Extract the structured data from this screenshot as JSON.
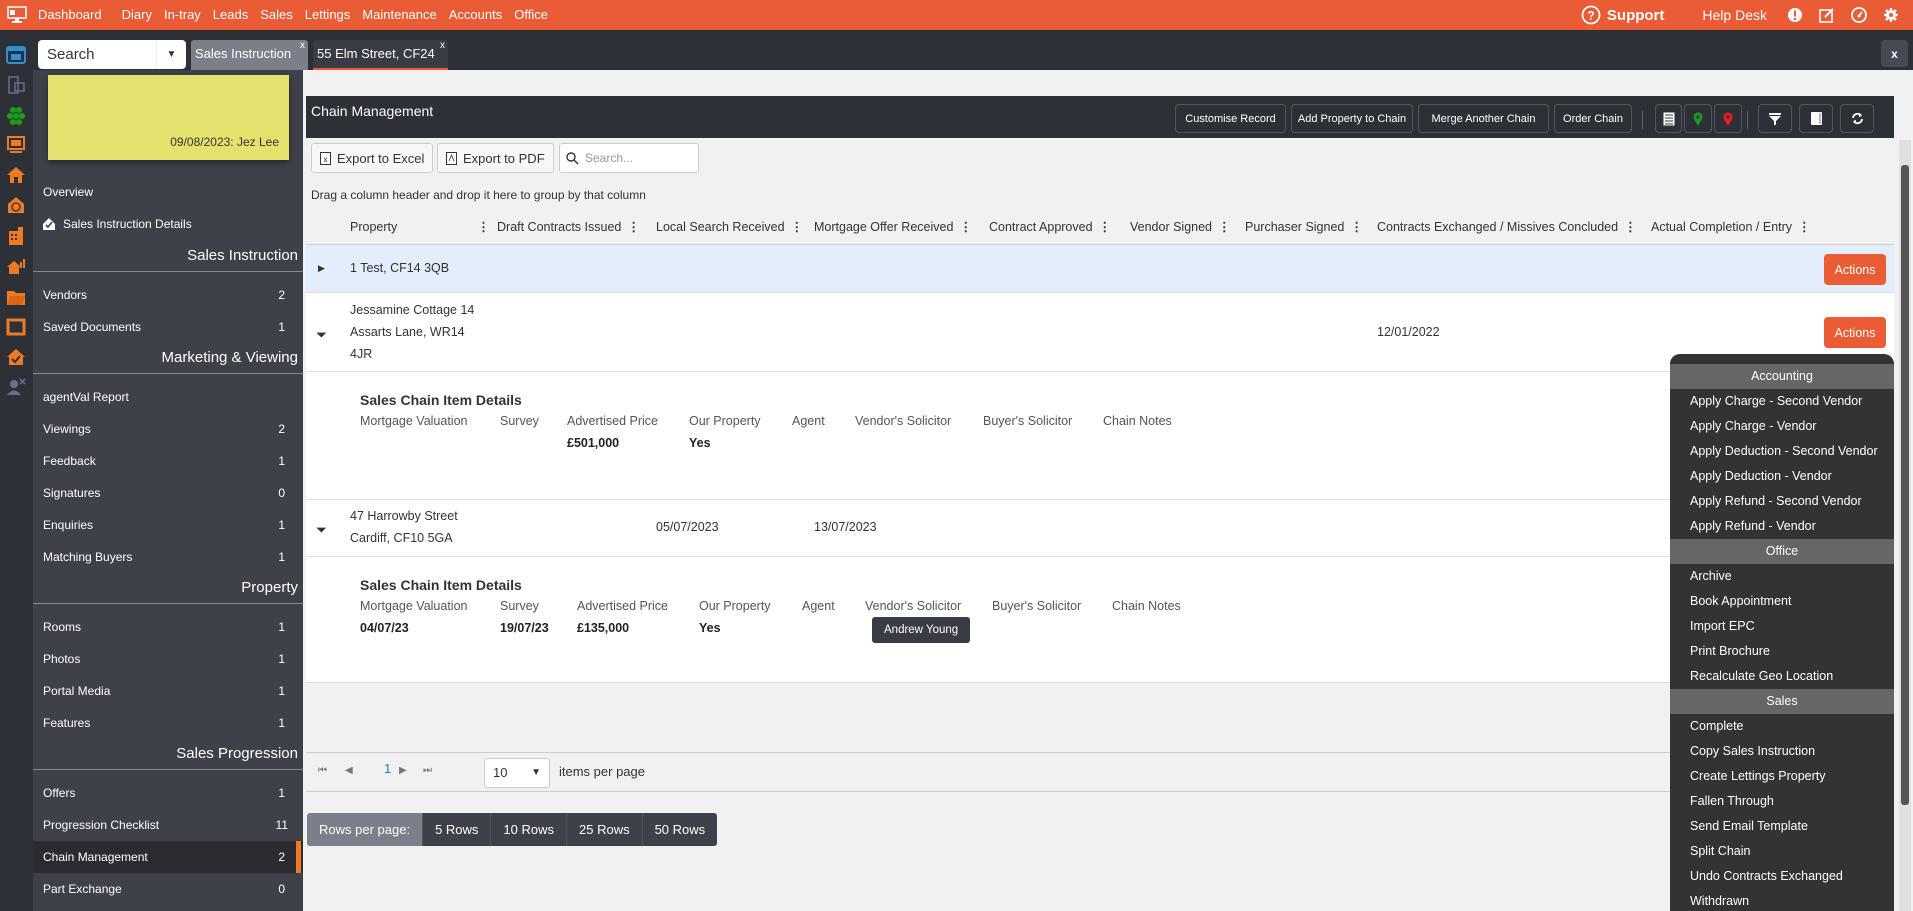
{
  "topnav": {
    "items": [
      "Dashboard",
      "Diary",
      "In-tray",
      "Leads",
      "Sales",
      "Lettings",
      "Maintenance",
      "Accounts",
      "Office"
    ],
    "support": "Support",
    "help_desk": "Help Desk"
  },
  "tabbar": {
    "search_placeholder": "Search",
    "tabs": [
      {
        "label": "Sales Instruction",
        "close": "x"
      },
      {
        "label": "55 Elm Street, CF24",
        "close": "x"
      }
    ],
    "close_all": "x"
  },
  "sidebar": {
    "note": "09/08/2023: Jez Lee",
    "overview": "Overview",
    "details": "Sales Instruction Details",
    "sections": [
      {
        "title": "Sales Instruction",
        "items": [
          {
            "label": "Vendors",
            "count": "2"
          },
          {
            "label": "Saved Documents",
            "count": "1"
          }
        ]
      },
      {
        "title": "Marketing & Viewing",
        "items": [
          {
            "label": "agentVal Report",
            "count": ""
          },
          {
            "label": "Viewings",
            "count": "2"
          },
          {
            "label": "Feedback",
            "count": "1"
          },
          {
            "label": "Signatures",
            "count": "0"
          },
          {
            "label": "Enquiries",
            "count": "1"
          },
          {
            "label": "Matching Buyers",
            "count": "1"
          }
        ]
      },
      {
        "title": "Property",
        "items": [
          {
            "label": "Rooms",
            "count": "1"
          },
          {
            "label": "Photos",
            "count": "1"
          },
          {
            "label": "Portal Media",
            "count": "1"
          },
          {
            "label": "Features",
            "count": "1"
          }
        ]
      },
      {
        "title": "Sales Progression",
        "items": [
          {
            "label": "Offers",
            "count": "1"
          },
          {
            "label": "Progression Checklist",
            "count": "11"
          },
          {
            "label": "Chain Management",
            "count": "2"
          },
          {
            "label": "Part Exchange",
            "count": "0"
          }
        ]
      }
    ]
  },
  "panel": {
    "title": "Chain Management",
    "buttons": [
      "Customise Record",
      "Add Property to Chain",
      "Merge Another Chain",
      "Order Chain"
    ],
    "export_excel": "Export to Excel",
    "export_pdf": "Export to PDF",
    "search_placeholder": "Search...",
    "group_hint": "Drag a column header and drop it here to group by that column"
  },
  "grid": {
    "columns": [
      "Property",
      "Draft Contracts Issued",
      "Local Search Received",
      "Mortgage Offer Received",
      "Contract Approved",
      "Vendor Signed",
      "Purchaser Signed",
      "Contracts Exchanged / Missives Concluded",
      "Actual Completion / Entry"
    ],
    "actions_label": "Actions",
    "rows": [
      {
        "property": [
          "1 Test, CF14 3QB"
        ],
        "local_search": "",
        "mortgage_offer": "",
        "contracts_exchanged": ""
      },
      {
        "property": [
          "Jessamine Cottage 14",
          "Assarts Lane, WR14",
          "4JR"
        ],
        "local_search": "",
        "mortgage_offer": "",
        "contracts_exchanged": "12/01/2022"
      },
      {
        "property": [
          "47 Harrowby Street",
          "Cardiff, CF10 5GA"
        ],
        "local_search": "05/07/2023",
        "mortgage_offer": "13/07/2023",
        "contracts_exchanged": ""
      }
    ],
    "details": [
      {
        "title": "Sales Chain Item Details",
        "labels": [
          "Mortgage Valuation",
          "Survey",
          "Advertised Price",
          "Our Property",
          "Agent",
          "Vendor's Solicitor",
          "Buyer's Solicitor",
          "Chain Notes"
        ],
        "mortgage_valuation": "",
        "survey": "",
        "price": "£501,000",
        "our_property": "Yes",
        "vendor_solicitor": ""
      },
      {
        "title": "Sales Chain Item Details",
        "labels": [
          "Mortgage Valuation",
          "Survey",
          "Advertised Price",
          "Our Property",
          "Agent",
          "Vendor's Solicitor",
          "Buyer's Solicitor",
          "Chain Notes"
        ],
        "mortgage_valuation": "04/07/23",
        "survey": "19/07/23",
        "price": "£135,000",
        "our_property": "Yes",
        "vendor_solicitor": "Andrew Young"
      }
    ]
  },
  "pager": {
    "current_page": "1",
    "page_size": "10",
    "items_per_page": "items per page"
  },
  "rows_per_page": {
    "label": "Rows per page:",
    "options": [
      "5 Rows",
      "10 Rows",
      "25 Rows",
      "50 Rows"
    ]
  },
  "actions_menu": {
    "groups": [
      {
        "title": "Accounting",
        "items": [
          "Apply Charge - Second Vendor",
          "Apply Charge - Vendor",
          "Apply Deduction - Second Vendor",
          "Apply Deduction - Vendor",
          "Apply Refund - Second Vendor",
          "Apply Refund - Vendor"
        ]
      },
      {
        "title": "Office",
        "items": [
          "Archive",
          "Book Appointment",
          "Import EPC",
          "Print Brochure",
          "Recalculate Geo Location"
        ]
      },
      {
        "title": "Sales",
        "items": [
          "Complete",
          "Copy Sales Instruction",
          "Create Lettings Property",
          "Fallen Through",
          "Send Email Template",
          "Split Chain",
          "Undo Contracts Exchanged",
          "Withdrawn"
        ]
      }
    ]
  },
  "colors": {
    "brand": "#e95c36",
    "dark": "#2e3038",
    "sidebar": "#3f414a",
    "accent_active": "#f07a22"
  }
}
